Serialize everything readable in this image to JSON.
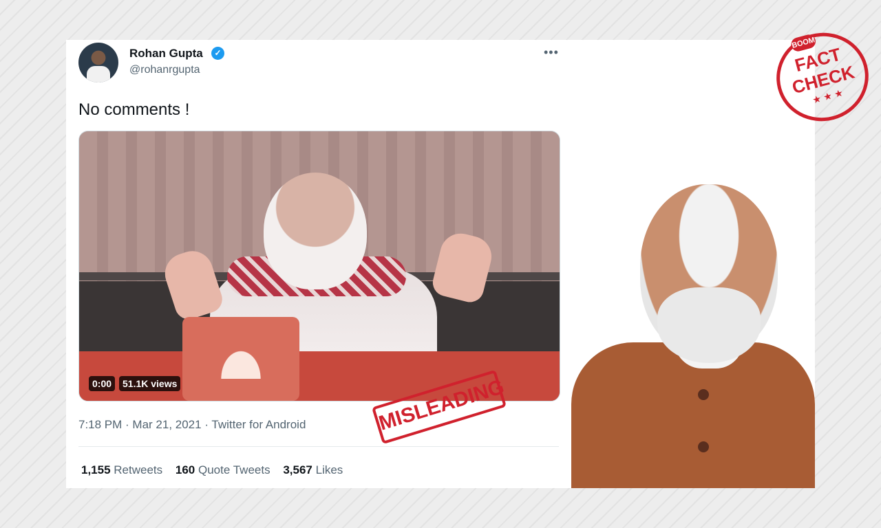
{
  "tweet": {
    "author_name": "Rohan Gupta",
    "handle": "@rohanrgupta",
    "verified_glyph": "✓",
    "more_glyph": "•••",
    "text": "No comments !",
    "video": {
      "time": "0:00",
      "views": "51.1K views"
    },
    "meta": "7:18 PM · Mar 21, 2021 · Twitter for Android",
    "stats": {
      "retweets_count": "1,155",
      "retweets_label": "Retweets",
      "quotes_count": "160",
      "quotes_label": "Quote Tweets",
      "likes_count": "3,567",
      "likes_label": "Likes"
    }
  },
  "overlays": {
    "misleading_stamp": "MISLEADING",
    "fact_check": {
      "brand": "BOOM",
      "line1": "FACT",
      "line2": "CHECK",
      "stars": "★ ★ ★"
    }
  },
  "colors": {
    "accent_blue": "#1d9bf0",
    "stamp_red": "#d0212d",
    "text_gray": "#536471"
  }
}
